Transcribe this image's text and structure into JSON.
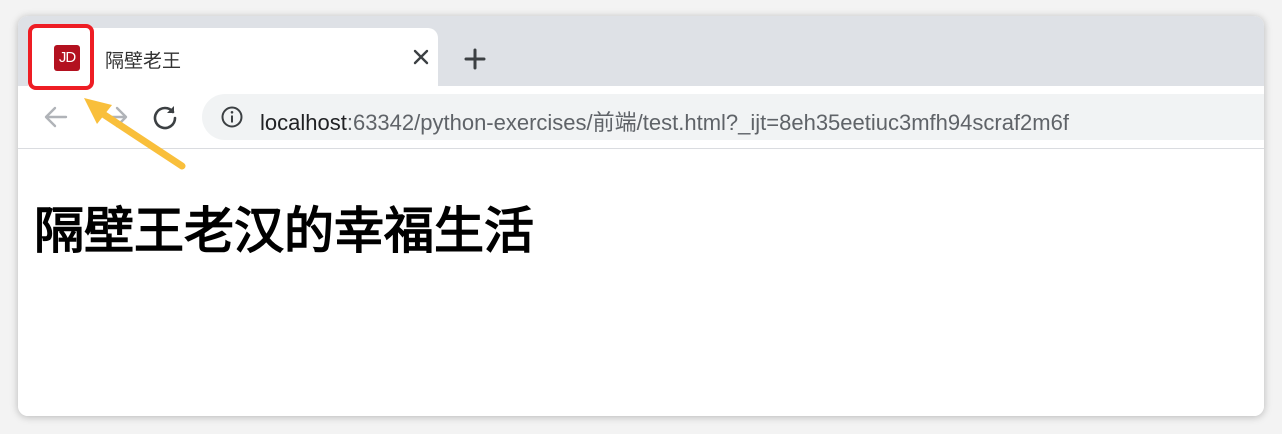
{
  "tab": {
    "favicon_text": "JD",
    "title": "隔壁老王",
    "close_icon": "close-icon"
  },
  "tabstrip": {
    "new_tab_icon": "plus-icon"
  },
  "toolbar": {
    "back_icon": "arrow-left-icon",
    "forward_icon": "arrow-right-icon",
    "reload_icon": "reload-icon",
    "info_icon": "info-icon",
    "url_host": "localhost",
    "url_rest": ":63342/python-exercises/前端/test.html?_ijt=8eh35eetiuc3mfh94scraf2m6f"
  },
  "page": {
    "heading": "隔壁王老汉的幸福生活"
  },
  "annotation": {
    "highlight_color": "#ee1d24",
    "arrow_color": "#f9bf3b"
  }
}
